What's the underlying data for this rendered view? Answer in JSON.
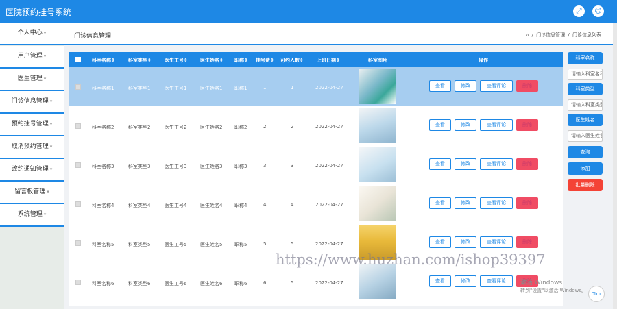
{
  "app": {
    "title": "医院预约挂号系统",
    "fullscreen_icon": "expand-icon",
    "user_icon": "user-icon"
  },
  "sidebar": {
    "items": [
      {
        "label": "个人中心"
      },
      {
        "label": "用户管理"
      },
      {
        "label": "医生管理"
      },
      {
        "label": "门诊信息管理"
      },
      {
        "label": "预约挂号管理"
      },
      {
        "label": "取消预约管理"
      },
      {
        "label": "改约通知管理"
      },
      {
        "label": "留言板管理"
      },
      {
        "label": "系统管理"
      }
    ]
  },
  "breadcrumb": {
    "title": "门诊信息管理",
    "home_icon": "home-icon",
    "path": [
      "门诊信息管理",
      "门诊信息列表"
    ],
    "separator": "/"
  },
  "table": {
    "headers": [
      "科室名称⇕",
      "科室类型⇕",
      "医生工号⇕",
      "医生姓名⇕",
      "职称⇕",
      "挂号费⇕",
      "可约人数⇕",
      "上班日期⇕",
      "科室图片",
      "操作"
    ],
    "rows": [
      {
        "dept": "科室名称1",
        "type": "科室类型1",
        "doc_id": "医生工号1",
        "doc_name": "医生姓名1",
        "title": "职称1",
        "fee": "1",
        "quota": "1",
        "date": "2022-04-27",
        "selected": true
      },
      {
        "dept": "科室名称2",
        "type": "科室类型2",
        "doc_id": "医生工号2",
        "doc_name": "医生姓名2",
        "title": "职称2",
        "fee": "2",
        "quota": "2",
        "date": "2022-04-27",
        "selected": false
      },
      {
        "dept": "科室名称3",
        "type": "科室类型3",
        "doc_id": "医生工号3",
        "doc_name": "医生姓名3",
        "title": "职称3",
        "fee": "3",
        "quota": "3",
        "date": "2022-04-27",
        "selected": false
      },
      {
        "dept": "科室名称4",
        "type": "科室类型4",
        "doc_id": "医生工号4",
        "doc_name": "医生姓名4",
        "title": "职称4",
        "fee": "4",
        "quota": "4",
        "date": "2022-04-27",
        "selected": false
      },
      {
        "dept": "科室名称5",
        "type": "科室类型5",
        "doc_id": "医生工号5",
        "doc_name": "医生姓名5",
        "title": "职称5",
        "fee": "5",
        "quota": "5",
        "date": "2022-04-27",
        "selected": false
      },
      {
        "dept": "科室名称6",
        "type": "科室类型6",
        "doc_id": "医生工号6",
        "doc_name": "医生姓名6",
        "title": "职称6",
        "fee": "6",
        "quota": "5",
        "date": "2022-04-27",
        "selected": false
      }
    ],
    "actions": {
      "view": "查看",
      "edit": "修改",
      "review": "查看评论",
      "delete": "删除"
    }
  },
  "search_panel": {
    "dept_label": "科室名称",
    "dept_placeholder": "请输入科室名称",
    "type_label": "科室类型",
    "type_placeholder": "请输入科室类型",
    "doc_label": "医生姓名",
    "doc_placeholder": "请输入医生姓名",
    "search": "查询",
    "add": "添加",
    "batch_delete": "批量删除"
  },
  "watermark": "https://www.huzhan.com/ishop39397",
  "windows": {
    "activate": "激活 Windows",
    "hint": "转到\"设置\"以激活 Windows。"
  },
  "back_to_top": "Top",
  "colors": {
    "primary": "#1e88e5",
    "danger": "#f44336",
    "selected_row": "#a6cdf0"
  }
}
